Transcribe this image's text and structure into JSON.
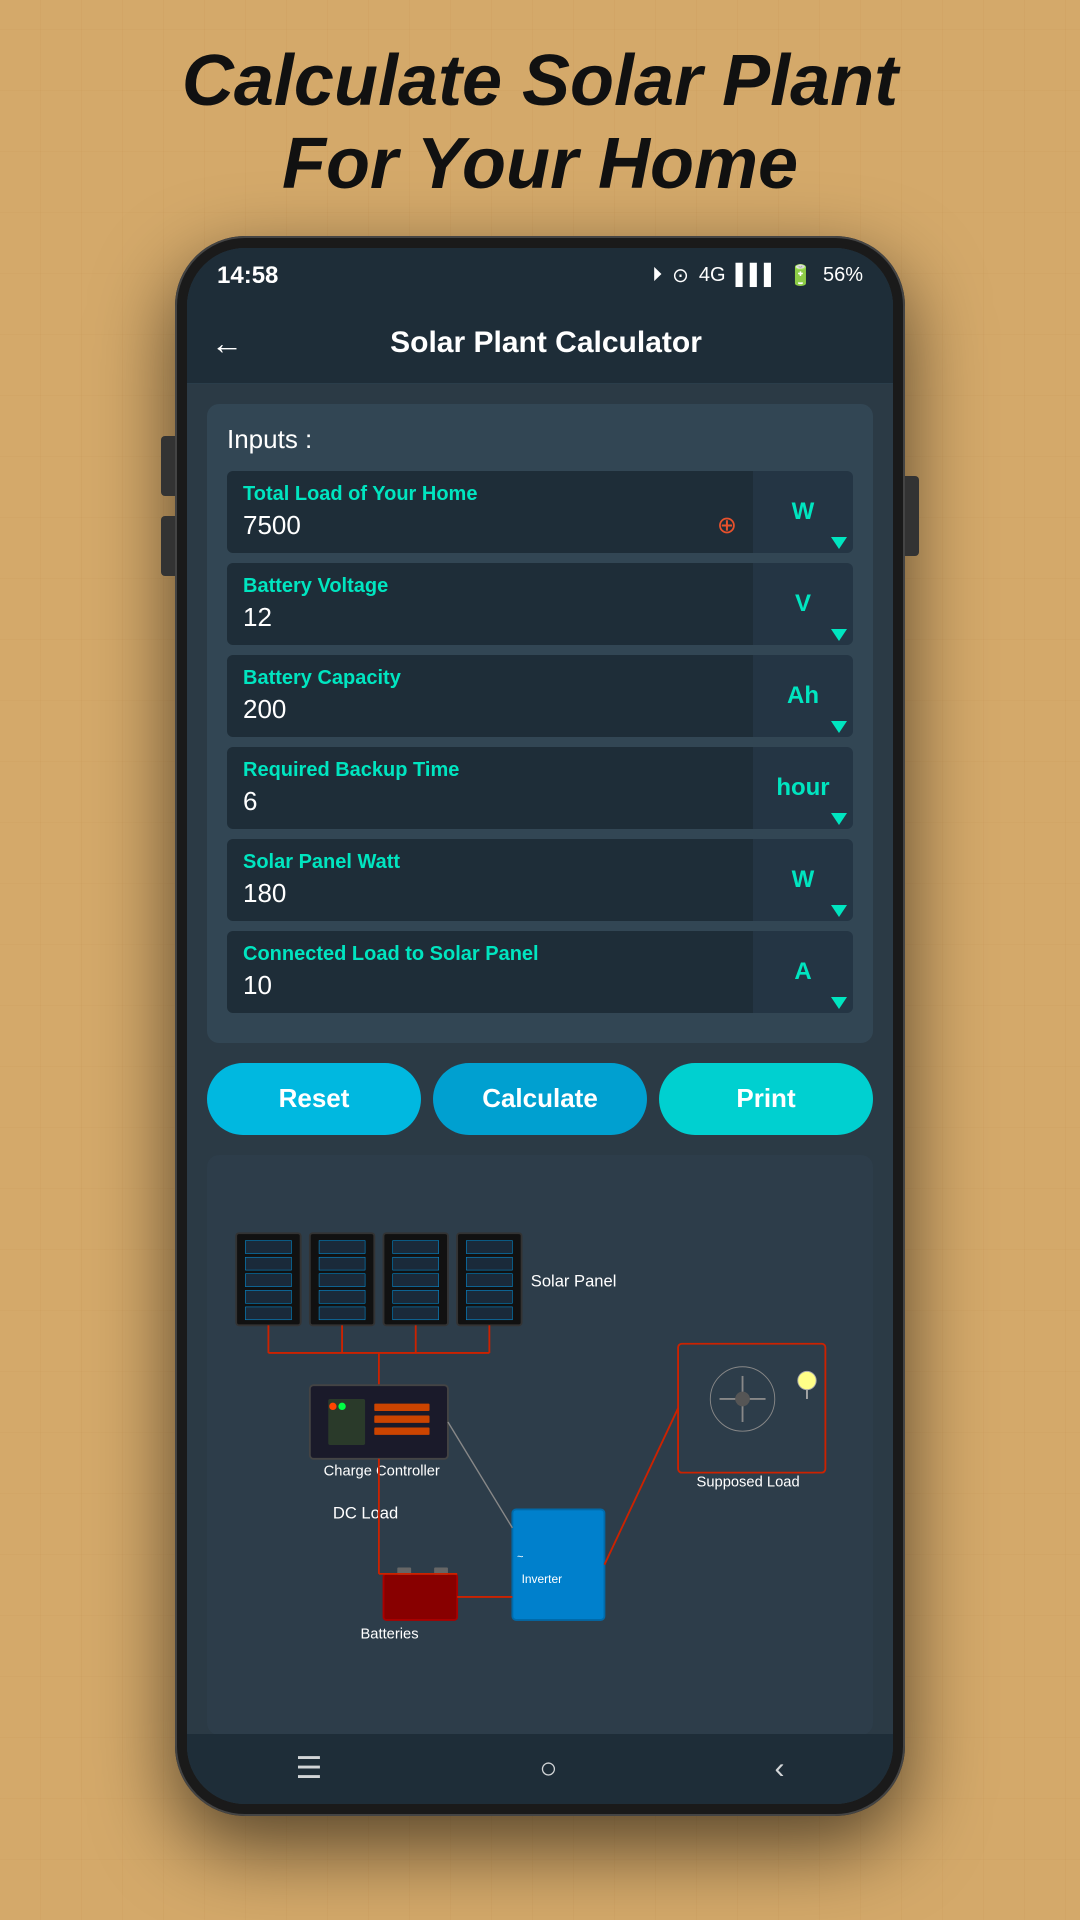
{
  "page": {
    "title_line1": "Calculate Solar Plant",
    "title_line2": "For Your Home"
  },
  "status_bar": {
    "time": "14:58",
    "network": "4G",
    "battery": "56%"
  },
  "app_bar": {
    "title": "Solar Plant Calculator",
    "back_label": "←"
  },
  "inputs_section": {
    "label": "Inputs :",
    "fields": [
      {
        "id": "total-load",
        "label": "Total Load of Your Home",
        "value": "7500",
        "unit": "W",
        "has_warning": true
      },
      {
        "id": "battery-voltage",
        "label": "Battery Voltage",
        "value": "12",
        "unit": "V",
        "has_warning": false
      },
      {
        "id": "battery-capacity",
        "label": "Battery Capacity",
        "value": "200",
        "unit": "Ah",
        "has_warning": false
      },
      {
        "id": "backup-time",
        "label": "Required Backup Time",
        "value": "6",
        "unit": "hour",
        "has_warning": false
      },
      {
        "id": "solar-watt",
        "label": "Solar Panel Watt",
        "value": "180",
        "unit": "W",
        "has_warning": false
      },
      {
        "id": "connected-load",
        "label": "Connected Load to Solar Panel",
        "value": "10",
        "unit": "A",
        "has_warning": false
      }
    ]
  },
  "buttons": {
    "reset": "Reset",
    "calculate": "Calculate",
    "print": "Print"
  },
  "diagram": {
    "solar_panel_label": "Solar Panel",
    "charge_controller_label": "Charge Controller",
    "dc_load_label": "DC Load",
    "inverter_label": "Inverter",
    "batteries_label": "Batteries",
    "supposed_load_label": "Supposed Load"
  },
  "bottom_nav": {
    "menu_icon": "☰",
    "home_icon": "○",
    "back_icon": "‹"
  }
}
